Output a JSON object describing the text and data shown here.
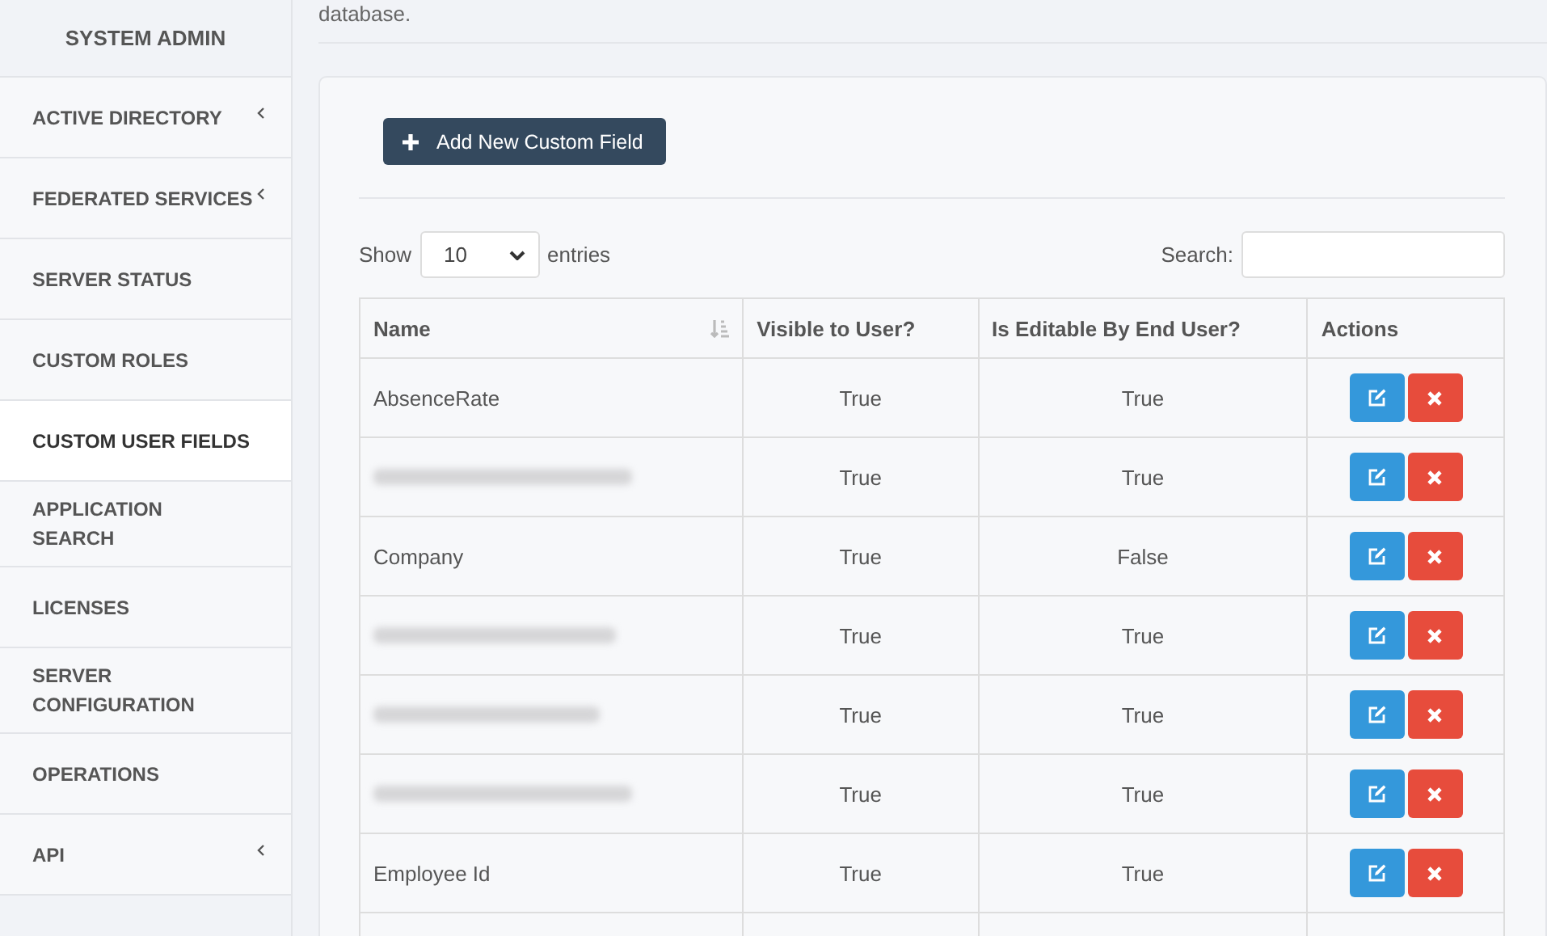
{
  "sidebar": {
    "title": "SYSTEM ADMIN",
    "items": [
      {
        "label": "ACTIVE DIRECTORY",
        "selected": false,
        "expandable": true
      },
      {
        "label": "FEDERATED SERVICES",
        "selected": false,
        "expandable": true
      },
      {
        "label": "SERVER STATUS",
        "selected": false,
        "expandable": false
      },
      {
        "label": "CUSTOM ROLES",
        "selected": false,
        "expandable": false
      },
      {
        "label": "CUSTOM USER FIELDS",
        "selected": true,
        "expandable": false
      },
      {
        "label": "APPLICATION SEARCH",
        "selected": false,
        "expandable": false
      },
      {
        "label": "LICENSES",
        "selected": false,
        "expandable": false
      },
      {
        "label": "SERVER CONFIGURATION",
        "selected": false,
        "expandable": false
      },
      {
        "label": "OPERATIONS",
        "selected": false,
        "expandable": false
      },
      {
        "label": "API",
        "selected": false,
        "expandable": true
      }
    ]
  },
  "intro_text": "database.",
  "add_button": "Add New Custom Field",
  "length_control": {
    "prefix": "Show",
    "value": "10",
    "suffix": "entries"
  },
  "search": {
    "label": "Search:"
  },
  "table": {
    "columns": [
      "Name",
      "Visible to User?",
      "Is Editable By End User?",
      "Actions"
    ],
    "rows": [
      {
        "name": "AbsenceRate",
        "redacted": false,
        "visible": "True",
        "editable": "True"
      },
      {
        "redacted": true,
        "visible": "True",
        "editable": "True"
      },
      {
        "name": "Company",
        "redacted": false,
        "visible": "True",
        "editable": "False"
      },
      {
        "redacted": true,
        "visible": "True",
        "editable": "True"
      },
      {
        "redacted": true,
        "visible": "True",
        "editable": "True"
      },
      {
        "redacted": true,
        "visible": "True",
        "editable": "True"
      },
      {
        "name": "Employee Id",
        "redacted": false,
        "visible": "True",
        "editable": "True"
      }
    ]
  }
}
